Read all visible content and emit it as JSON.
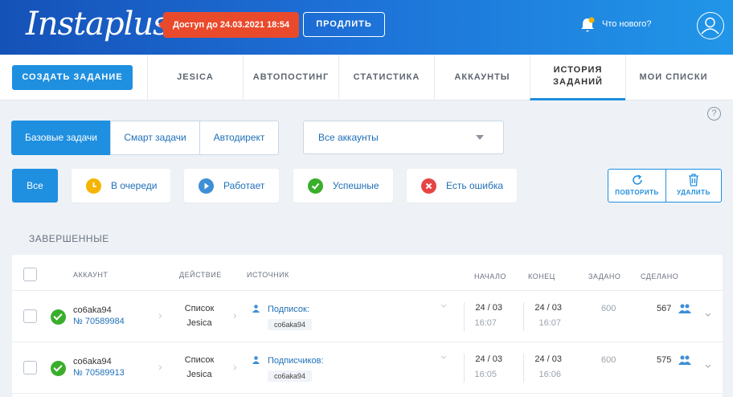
{
  "header": {
    "logo": "Instaplus",
    "access_badge": "Доступ до 24.03.2021 18:54",
    "extend_button": "ПРОДЛИТЬ",
    "news_link": "Что нового?",
    "icons": {
      "bell": "bell-icon",
      "avatar": "user-avatar-icon"
    }
  },
  "nav": {
    "create_button": "СОЗДАТЬ ЗАДАНИЕ",
    "tabs": [
      {
        "label": "JESICA"
      },
      {
        "label": "АВТОПОСТИНГ"
      },
      {
        "label": "СТАТИСТИКА"
      },
      {
        "label": "АККАУНТЫ"
      },
      {
        "label": "ИСТОРИЯ ЗАДАНИЙ",
        "active": true
      },
      {
        "label": "МОИ СПИСКИ"
      }
    ]
  },
  "help": "?",
  "task_types": [
    {
      "label": "Базовые задачи",
      "active": true
    },
    {
      "label": "Смарт задачи"
    },
    {
      "label": "Автодирект"
    }
  ],
  "account_select": {
    "value": "Все аккаунты"
  },
  "filters": [
    {
      "label": "Все",
      "active": true
    },
    {
      "label": "В очереди",
      "icon": "clock-icon",
      "color": "#f5b400"
    },
    {
      "label": "Работает",
      "icon": "play-icon",
      "color": "#3e8fd6"
    },
    {
      "label": "Успешные",
      "icon": "check-icon",
      "color": "#3aae2c"
    },
    {
      "label": "Есть ошибка",
      "icon": "close-icon",
      "color": "#e64545"
    }
  ],
  "actions": {
    "repeat": "ПОВТОРИТЬ",
    "delete": "УДАЛИТЬ"
  },
  "section_title": "ЗАВЕРШЕННЫЕ",
  "table": {
    "columns": {
      "account": "АККАУНТ",
      "action": "ДЕЙСТВИЕ",
      "source": "ИСТОЧНИК",
      "start": "НАЧАЛО",
      "end": "КОНЕЦ",
      "set": "ЗАДАНО",
      "done": "СДЕЛАНО"
    },
    "rows": [
      {
        "account": "co6aka94",
        "number": "№ 70589984",
        "action_line1": "Список",
        "action_line2": "Jesica",
        "source_label": "Подписок:",
        "source_tag": "co6aka94",
        "start_date": "24 / 03",
        "start_time": "16:07",
        "end_date": "24 / 03",
        "end_time": "16:07",
        "set": "600",
        "done": "567"
      },
      {
        "account": "co6aka94",
        "number": "№ 70589913",
        "action_line1": "Список",
        "action_line2": "Jesica",
        "source_label": "Подписчиков:",
        "source_tag": "co6aka94",
        "start_date": "24 / 03",
        "start_time": "16:05",
        "end_date": "24 / 03",
        "end_time": "16:06",
        "set": "600",
        "done": "575"
      }
    ]
  },
  "colors": {
    "accent": "#1f8fe0",
    "badge": "#ea4a2c",
    "success": "#3aae2c"
  }
}
